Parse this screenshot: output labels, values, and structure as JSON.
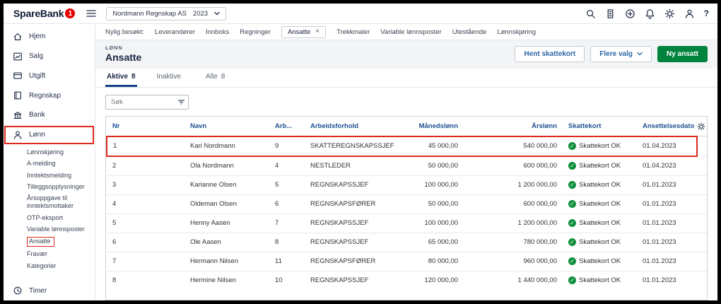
{
  "topbar": {
    "brand": "SpareBank",
    "badge": "1",
    "company": {
      "name": "Nordmann Regnskap AS",
      "year": "2023"
    },
    "icons": [
      "search-icon",
      "building-icon",
      "plus-circle-icon",
      "bell-icon",
      "gear-icon",
      "user-icon",
      "help-icon"
    ],
    "help_glyph": "?"
  },
  "sidebar": {
    "items": [
      {
        "label": "Hjem",
        "icon": "home-icon"
      },
      {
        "label": "Salg",
        "icon": "chart-icon"
      },
      {
        "label": "Utgift",
        "icon": "card-icon"
      },
      {
        "label": "Regnskap",
        "icon": "book-icon"
      },
      {
        "label": "Bank",
        "icon": "bank-icon"
      },
      {
        "label": "Lønn",
        "icon": "person-icon",
        "annotated": true
      }
    ],
    "submenu": [
      {
        "label": "Lønnskjøring"
      },
      {
        "label": "A-melding"
      },
      {
        "label": "Inntektsmelding"
      },
      {
        "label": "Tilleggsopplysninger"
      },
      {
        "label": "Årsoppgave til inntektsmottaker"
      },
      {
        "label": "OTP-eksport"
      },
      {
        "label": "Variable lønnsposter"
      },
      {
        "label": "Ansatte",
        "annotated": true
      },
      {
        "label": "Fravær"
      },
      {
        "label": "Kategorier"
      }
    ],
    "timer": {
      "label": "Timer",
      "icon": "clock-icon"
    }
  },
  "tabstrip": {
    "prefix": "Nylig besøkt:",
    "close_glyph": "×",
    "tabs": [
      {
        "label": "Leverandører"
      },
      {
        "label": "Innboks"
      },
      {
        "label": "Regninger"
      },
      {
        "label": "Ansatte",
        "active": true,
        "closable": true
      },
      {
        "label": "Trekkmaler"
      },
      {
        "label": "Variable lønnsposter"
      },
      {
        "label": "Utestående"
      },
      {
        "label": "Lønnskjøring"
      }
    ]
  },
  "page": {
    "eyebrow": "LØNN",
    "title": "Ansatte",
    "actions": {
      "hent_skattekort": "Hent skattekort",
      "flere_valg": "Flere valg",
      "ny_ansatt": "Ny ansatt"
    },
    "tabs": [
      {
        "label": "Aktive",
        "count": "8",
        "active": true
      },
      {
        "label": "Inaktive",
        "count": ""
      },
      {
        "label": "Alle",
        "count": "8"
      }
    ],
    "search": {
      "placeholder": "Søk"
    }
  },
  "table": {
    "headers": {
      "nr": "Nr",
      "navn": "Navn",
      "arb": "Arb...",
      "arbeidsforhold": "Arbeidsforhold",
      "manedslonn": "Månedslønn",
      "arslonn": "Årslønn",
      "skattekort": "Skattekort",
      "ansettelsesdato": "Ansettelsesdato"
    },
    "rows": [
      {
        "nr": "1",
        "navn": "Kari Nordmann",
        "arb": "9",
        "stilling": "SKATTEREGNSKAPSSJEF",
        "manedslonn": "45 000,00",
        "arslonn": "540 000,00",
        "skattekort": "Skattekort OK",
        "dato": "01.04.2023",
        "annotated": true
      },
      {
        "nr": "2",
        "navn": "Ola Nordmann",
        "arb": "4",
        "stilling": "NESTLEDER",
        "manedslonn": "50 000,00",
        "arslonn": "600 000,00",
        "skattekort": "Skattekort OK",
        "dato": "01.04.2023"
      },
      {
        "nr": "3",
        "navn": "Karianne Olsen",
        "arb": "5",
        "stilling": "REGNSKAPSSJEF",
        "manedslonn": "100 000,00",
        "arslonn": "1 200 000,00",
        "skattekort": "Skattekort OK",
        "dato": "01.01.2023"
      },
      {
        "nr": "4",
        "navn": "Oldeman Olsen",
        "arb": "6",
        "stilling": "REGNSKAPSFØRER",
        "manedslonn": "50 000,00",
        "arslonn": "600 000,00",
        "skattekort": "Skattekort OK",
        "dato": "01.01.2023"
      },
      {
        "nr": "5",
        "navn": "Henny Aasen",
        "arb": "7",
        "stilling": "REGNSKAPSSJEF",
        "manedslonn": "100 000,00",
        "arslonn": "1 200 000,00",
        "skattekort": "Skattekort OK",
        "dato": "01.01.2023"
      },
      {
        "nr": "6",
        "navn": "Ole Aasen",
        "arb": "8",
        "stilling": "REGNSKAPSSJEF",
        "manedslonn": "65 000,00",
        "arslonn": "780 000,00",
        "skattekort": "Skattekort OK",
        "dato": "01.01.2023"
      },
      {
        "nr": "7",
        "navn": "Hermann Nilsen",
        "arb": "11",
        "stilling": "REGNSKAPSFØRER",
        "manedslonn": "80 000,00",
        "arslonn": "960 000,00",
        "skattekort": "Skattekort OK",
        "dato": "01.01.2023"
      },
      {
        "nr": "8",
        "navn": "Hermine Nilsen",
        "arb": "10",
        "stilling": "REGNSKAPSSJEF",
        "manedslonn": "120 000,00",
        "arslonn": "1 440 000,00",
        "skattekort": "Skattekort OK",
        "dato": "01.01.2023"
      }
    ]
  },
  "colors": {
    "brand_red": "#e60000",
    "brand_navy": "#0d1b33",
    "accent_green": "#00843d",
    "link_blue": "#2c66a5",
    "table_header_blue": "#1d4f91",
    "status_green": "#0f8f3c",
    "annotation_red": "#e0291c",
    "header_band_gray": "#f3f4f6"
  }
}
